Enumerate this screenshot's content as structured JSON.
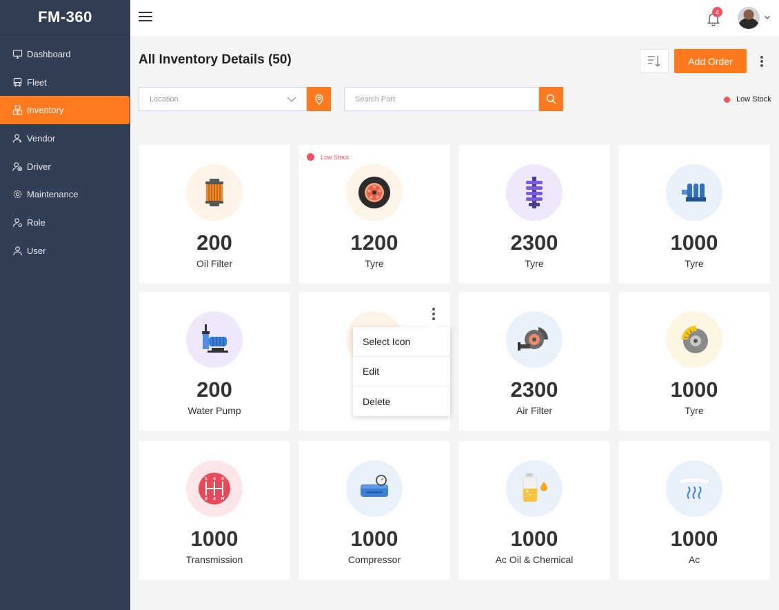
{
  "brand": "FM-360",
  "sidebar": {
    "items": [
      {
        "label": "Dashboard",
        "icon": "monitor-icon"
      },
      {
        "label": "Fleet",
        "icon": "bus-icon"
      },
      {
        "label": "Inventory",
        "icon": "boxes-icon",
        "active": true
      },
      {
        "label": "Vendor",
        "icon": "user-tie-icon"
      },
      {
        "label": "Driver",
        "icon": "driver-icon"
      },
      {
        "label": "Maintenance",
        "icon": "gear-icon"
      },
      {
        "label": "Role",
        "icon": "role-icon"
      },
      {
        "label": "User",
        "icon": "user-icon"
      }
    ]
  },
  "topbar": {
    "notification_count": "4"
  },
  "page": {
    "title": "All Inventory Details (50)",
    "add_order_label": "Add Order",
    "location_placeholder": "Location",
    "search_placeholder": "Search Part",
    "legend_label": "Low Stock"
  },
  "cards": [
    {
      "qty": "200",
      "name": "Oil Filter",
      "icon": "oil-filter-icon",
      "bg": "#fdf3e6"
    },
    {
      "qty": "1200",
      "name": "Tyre",
      "icon": "tyre-icon",
      "bg": "#fdf3e6",
      "low_stock": "Low Stock"
    },
    {
      "qty": "2300",
      "name": "Tyre",
      "icon": "suspension-spring-icon",
      "bg": "#efe8fb"
    },
    {
      "qty": "1000",
      "name": "Tyre",
      "icon": "engine-block-icon",
      "bg": "#e9f1fb"
    },
    {
      "qty": "200",
      "name": "Water Pump",
      "icon": "water-pump-icon",
      "bg": "#efe8fb"
    },
    {
      "qty": "",
      "name": "",
      "icon": "hidden-icon",
      "bg": "#fdf3e6"
    },
    {
      "qty": "2300",
      "name": "Air Filter",
      "icon": "turbo-icon",
      "bg": "#e9f1fb"
    },
    {
      "qty": "1000",
      "name": "Tyre",
      "icon": "brake-disc-icon",
      "bg": "#fdf6e3"
    },
    {
      "qty": "1000",
      "name": "Transmission",
      "icon": "gear-shift-icon",
      "bg": "#fde6e8"
    },
    {
      "qty": "1000",
      "name": "Compressor",
      "icon": "compressor-icon",
      "bg": "#e9f1fb"
    },
    {
      "qty": "1000",
      "name": "Ac Oil & Chemical",
      "icon": "oil-can-icon",
      "bg": "#e9f1fb"
    },
    {
      "qty": "1000",
      "name": "Ac",
      "icon": "ac-vent-icon",
      "bg": "#e9f1fb"
    }
  ],
  "context_menu": {
    "items": [
      "Select Icon",
      "Edit",
      "Delete"
    ]
  },
  "colors": {
    "accent": "#ff7a1f",
    "sidebar": "#323e54",
    "low_stock": "#ef5461"
  }
}
